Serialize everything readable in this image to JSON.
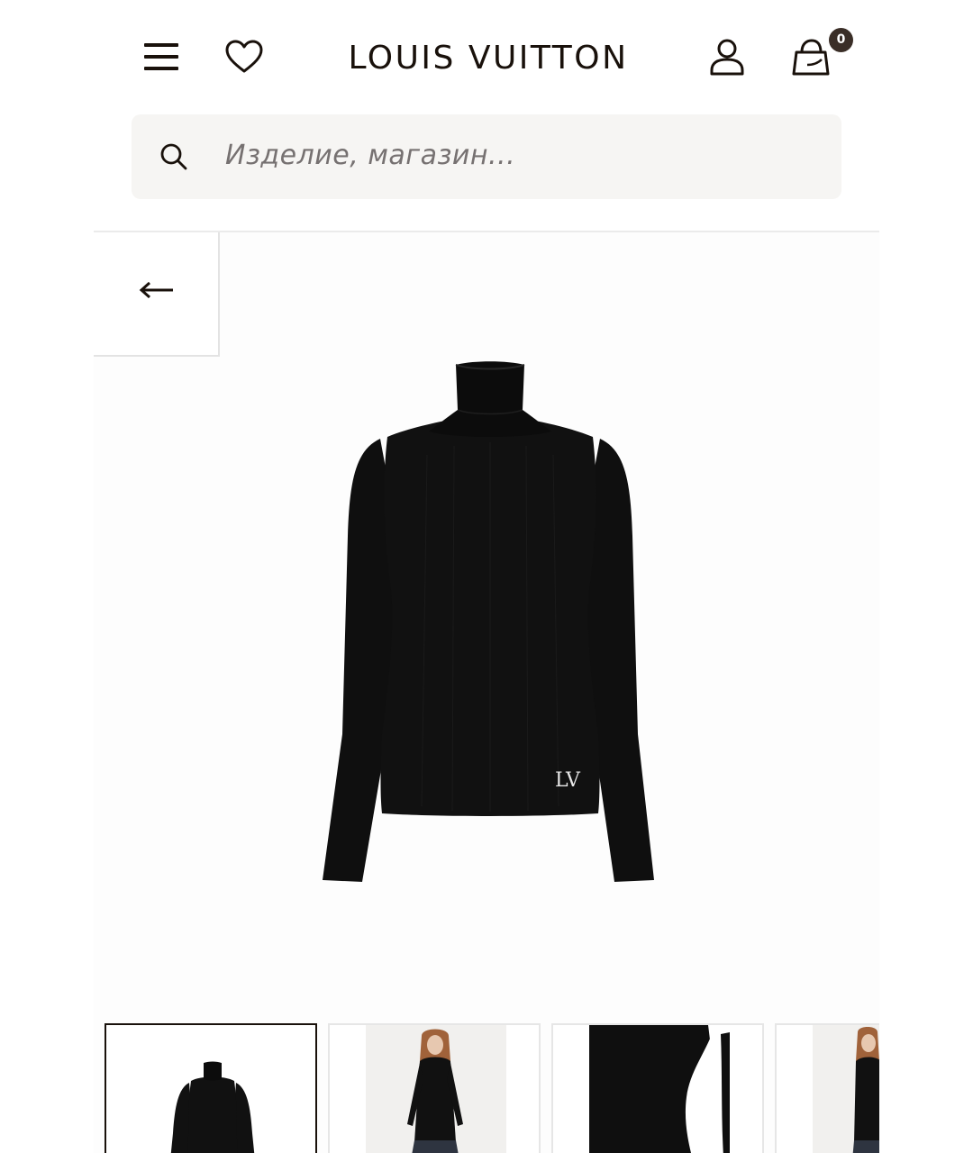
{
  "header": {
    "brand_logo": "LOUIS VUITTON",
    "bag_count": "0",
    "icons": [
      "menu-icon",
      "heart-icon",
      "account-icon",
      "shopping-bag-icon"
    ]
  },
  "search": {
    "placeholder": "Изделие, магазин..."
  },
  "navigation": {
    "back_icon": "arrow-left-icon"
  },
  "product": {
    "image": "black-turtleneck-sweater"
  },
  "gallery": {
    "thumbnails": [
      {
        "image": "sweater-front",
        "selected": true
      },
      {
        "image": "model-full-view",
        "selected": false
      },
      {
        "image": "sleeve-detail",
        "selected": false
      },
      {
        "image": "model-side-view",
        "selected": false
      }
    ]
  },
  "colors": {
    "text": "#19110b",
    "search_bg": "#f6f5f3",
    "badge_bg": "#3a2e27"
  }
}
